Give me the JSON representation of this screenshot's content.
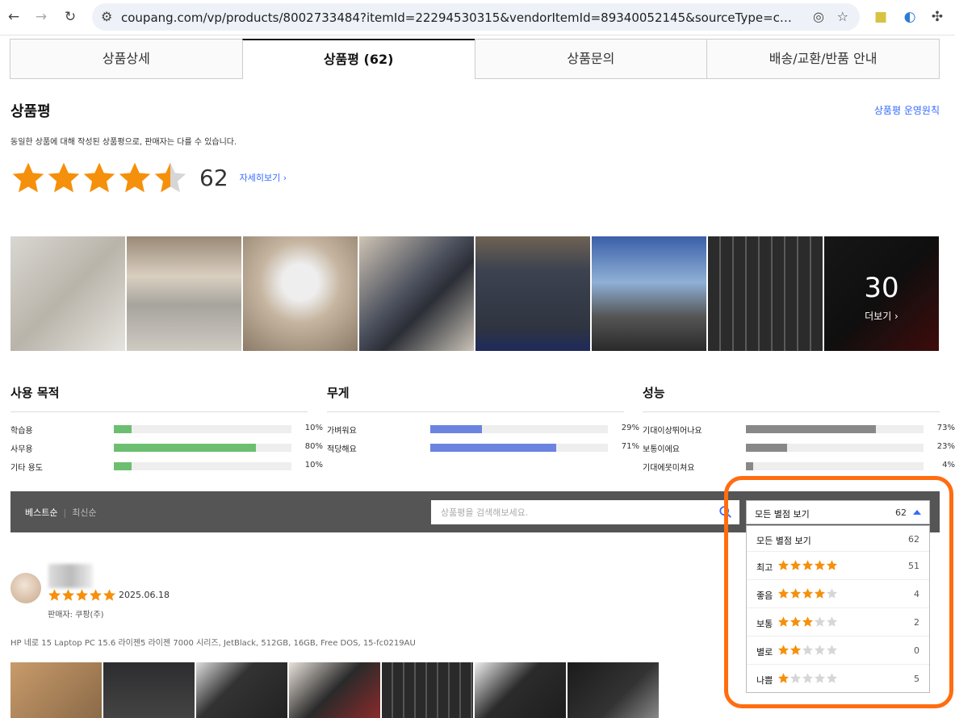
{
  "browser": {
    "url": "coupang.com/vp/products/8002733484?itemId=22294530315&vendorItemId=89340052145&sourceType=cmgoms&subSourceTyp..."
  },
  "tabs": [
    {
      "label": "상품상세"
    },
    {
      "label": "상품평 (62)"
    },
    {
      "label": "상품문의"
    },
    {
      "label": "배송/교환/반품 안내"
    }
  ],
  "review": {
    "title": "상품평",
    "policy_link": "상품평 운영원칙",
    "notice": "동일한 상품에 대해 작성된 상품평으로, 판매자는 다를 수 있습니다.",
    "rating_value": 4.5,
    "count": "62",
    "detail_link": "자세히보기 ›",
    "more_count": "30",
    "more_label": "더보기 ›"
  },
  "surveys": [
    {
      "title": "사용 목적",
      "color": "#6cbf70",
      "rows": [
        {
          "label": "학습용",
          "pct": "10%",
          "value": 10
        },
        {
          "label": "사무용",
          "pct": "80%",
          "value": 80
        },
        {
          "label": "기타 용도",
          "pct": "10%",
          "value": 10
        }
      ]
    },
    {
      "title": "무게",
      "color": "#6b84e0",
      "rows": [
        {
          "label": "가벼워요",
          "pct": "29%",
          "value": 29
        },
        {
          "label": "적당해요",
          "pct": "71%",
          "value": 71
        }
      ]
    },
    {
      "title": "성능",
      "color": "#888888",
      "rows": [
        {
          "label": "기대이상뛰어나요",
          "pct": "73%",
          "value": 73
        },
        {
          "label": "보통이에요",
          "pct": "23%",
          "value": 23
        },
        {
          "label": "기대에못미쳐요",
          "pct": "4%",
          "value": 4
        }
      ]
    }
  ],
  "toolbar": {
    "sort_best": "베스트순",
    "sort_sep": "|",
    "sort_recent": "최신순",
    "search_placeholder": "상품평을 검색해보세요.",
    "filter_label": "모든 별점 보기",
    "filter_count": "62"
  },
  "dropdown": [
    {
      "label": "모든 별점 보기",
      "stars": 0,
      "count": "62"
    },
    {
      "label": "최고",
      "stars": 5,
      "count": "51"
    },
    {
      "label": "좋음",
      "stars": 4,
      "count": "4"
    },
    {
      "label": "보통",
      "stars": 3,
      "count": "2"
    },
    {
      "label": "별로",
      "stars": 2,
      "count": "0"
    },
    {
      "label": "나쁨",
      "stars": 1,
      "count": "5"
    }
  ],
  "first_review": {
    "rating": 5,
    "date": "2025.06.18",
    "seller": "판매자: 쿠팡(주)",
    "product": "HP 네로 15 Laptop PC 15.6 라이젠5 라이젠 7000 시리즈, JetBlack, 512GB, 16GB, Free DOS, 15-fc0219AU"
  },
  "colors": {
    "star": "#f5900c",
    "star_empty": "#d6d6d6",
    "accent": "#346aff",
    "highlight": "#ff6d10"
  }
}
